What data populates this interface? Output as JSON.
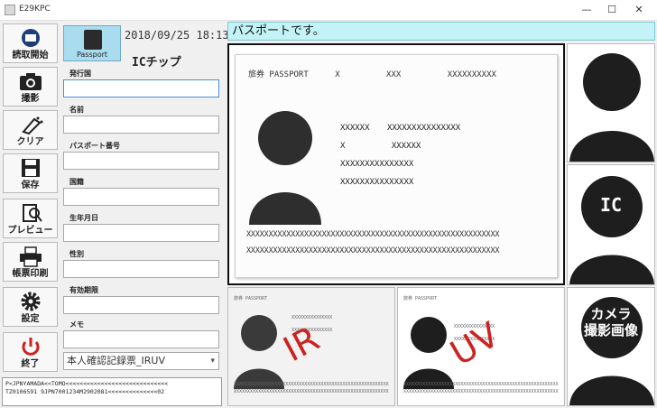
{
  "window": {
    "title": "E29KPC",
    "minimize": "—",
    "maximize": "☐",
    "close": "✕"
  },
  "toolbar": [
    {
      "label": "読取開始",
      "icon": "scan-icon"
    },
    {
      "label": "撮影",
      "icon": "camera-icon"
    },
    {
      "label": "クリア",
      "icon": "clear-icon"
    },
    {
      "label": "保存",
      "icon": "save-icon"
    },
    {
      "label": "プレビュー",
      "icon": "preview-icon"
    },
    {
      "label": "帳票印刷",
      "icon": "printer-icon"
    },
    {
      "label": "設定",
      "icon": "gear-icon"
    },
    {
      "label": "終了",
      "icon": "power-icon"
    }
  ],
  "passport_tab": {
    "label": "Passport"
  },
  "header": {
    "datetime": "2018/09/25 18:13",
    "ic_label": "ICチップ"
  },
  "form": {
    "fields": [
      {
        "label": "発行国",
        "value": ""
      },
      {
        "label": "名前",
        "value": ""
      },
      {
        "label": "パスポート番号",
        "value": ""
      },
      {
        "label": "国籍",
        "value": ""
      },
      {
        "label": "生年月日",
        "value": ""
      },
      {
        "label": "性別",
        "value": ""
      },
      {
        "label": "有効期限",
        "value": ""
      },
      {
        "label": "メモ",
        "value": ""
      }
    ],
    "report_select": "本人確認記録票_IRUV"
  },
  "mrz": {
    "line1": "P<JPNYAMADA<<TOMO<<<<<<<<<<<<<<<<<<<<<<<<<<<<<",
    "line2": "TZ0106591 9JPN7001234M2902081<<<<<<<<<<<<<<02"
  },
  "status": {
    "text": "パスポートです。"
  },
  "passport": {
    "head": "旅券 PASSPORT",
    "head_x": "X",
    "head_xxx": "XXX",
    "head_code": "XXXXXXXXXX",
    "lines": [
      {
        "a": "XXXXXX",
        "b": "XXXXXXXXXXXXXXX"
      },
      {
        "a": "X",
        "b": "XXXXXX"
      },
      {
        "a": "XXXXXXXXXXXXXXX",
        "b": ""
      },
      {
        "a": "XXXXXXXXXXXXXXX",
        "b": ""
      }
    ],
    "mrz1": "XXXXXXXXXXXXXXXXXXXXXXXXXXXXXXXXXXXXXXXXXXXXXXXXXXXXXXXXX",
    "mrz2": "XXXXXXXXXXXXXXXXXXXXXXXXXXXXXXXXXXXXXXXXXXXXXXXXXXXXXXXXX"
  },
  "side_images": {
    "ic_label": "IC",
    "camera_label_1": "カメラ",
    "camera_label_2": "撮影画像"
  },
  "thumbs": {
    "ir_mark": "IR",
    "uv_mark": "UV"
  },
  "colors": {
    "status_bg": "#c3f3f6",
    "tab_bg": "#a9dcef",
    "mark_red": "#cc2222"
  }
}
